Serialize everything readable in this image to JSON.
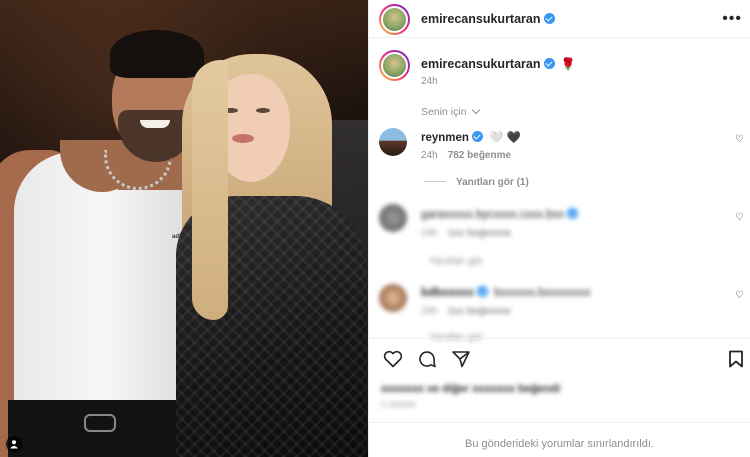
{
  "post": {
    "author": {
      "username": "emirecansukurtaran",
      "verified": true
    },
    "caption": {
      "username": "emirecansukurtaran",
      "emoji": "🌹",
      "time": "24h"
    },
    "filter_label": "Senin için",
    "comments": [
      {
        "username": "reynmen",
        "verified": true,
        "text": "🤍 🖤",
        "time": "24h",
        "likes": "782 beğenme",
        "replies_label": "Yanıtları gör (1)"
      },
      {
        "username": "garaxxxxx.bycxxxx.cxxx.bxx",
        "verified": true,
        "text": "",
        "time": "24h",
        "likes": "1xx beğenme",
        "replies_label": "Yanıtları gör"
      },
      {
        "username": "bdbxxxxx",
        "verified": true,
        "text": "bxxxxxx.bxxxxxxxx",
        "time": "24h",
        "likes": "1xx beğenme",
        "replies_label": "Yanıtları gör"
      }
    ],
    "likes_line": "xxxxxxx ve diğer xxxxxxx beğendi",
    "date_line": "1 xxxxxx",
    "comments_limited_text": "Bu gönderideki yorumlar sınırlandırıldı.",
    "tank_logo": "adidas",
    "icons": {
      "more": "more-horizontal-icon",
      "like": "heart-icon",
      "comment": "comment-icon",
      "share": "share-icon",
      "save": "bookmark-icon",
      "tagged": "person-tag-icon"
    },
    "colors": {
      "verified_badge": "#3897f0",
      "muted_text": "#8e8e8e",
      "primary_text": "#262626",
      "rose": "#d62b40"
    }
  }
}
